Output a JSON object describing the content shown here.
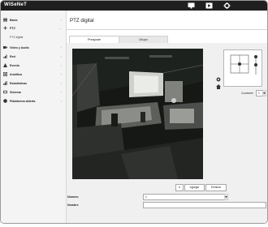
{
  "app": {
    "logo": "WISeNeT"
  },
  "topbar": {
    "icons": [
      "monitor-icon",
      "playback-icon",
      "gear-icon"
    ]
  },
  "sidebar": {
    "items": [
      {
        "label": "Básic",
        "icon": "grid-icon"
      },
      {
        "label": "PTZ",
        "icon": "ptz-icon",
        "sub": [
          "PTZ digital"
        ]
      },
      {
        "label": "Vídeo y Audio",
        "icon": "video-icon"
      },
      {
        "label": "Red",
        "icon": "network-icon"
      },
      {
        "label": "Evento",
        "icon": "event-icon"
      },
      {
        "label": "Analítica",
        "icon": "analytics-icon"
      },
      {
        "label": "Estadísticas",
        "icon": "stats-icon"
      },
      {
        "label": "Sistema",
        "icon": "system-icon"
      },
      {
        "label": "Plataforma abierta",
        "icon": "platform-icon"
      }
    ]
  },
  "main": {
    "title": "PTZ digital",
    "tabs": [
      {
        "label": "Preajuste"
      },
      {
        "label": "Grupo"
      }
    ],
    "ptz": {
      "speed_label": "Cuadrante",
      "speed_value": "1"
    },
    "buttons": {
      "go": "Ir",
      "add": "Agregar",
      "delete": "Eliminar"
    },
    "form": {
      "number_label": "Número",
      "number_value": "1",
      "name_label": "Nombre",
      "name_value": ""
    }
  },
  "colors": {
    "topbar": "#1f1f1f",
    "sidebar": "#f4f4f4",
    "panel": "#f0f0f0"
  }
}
